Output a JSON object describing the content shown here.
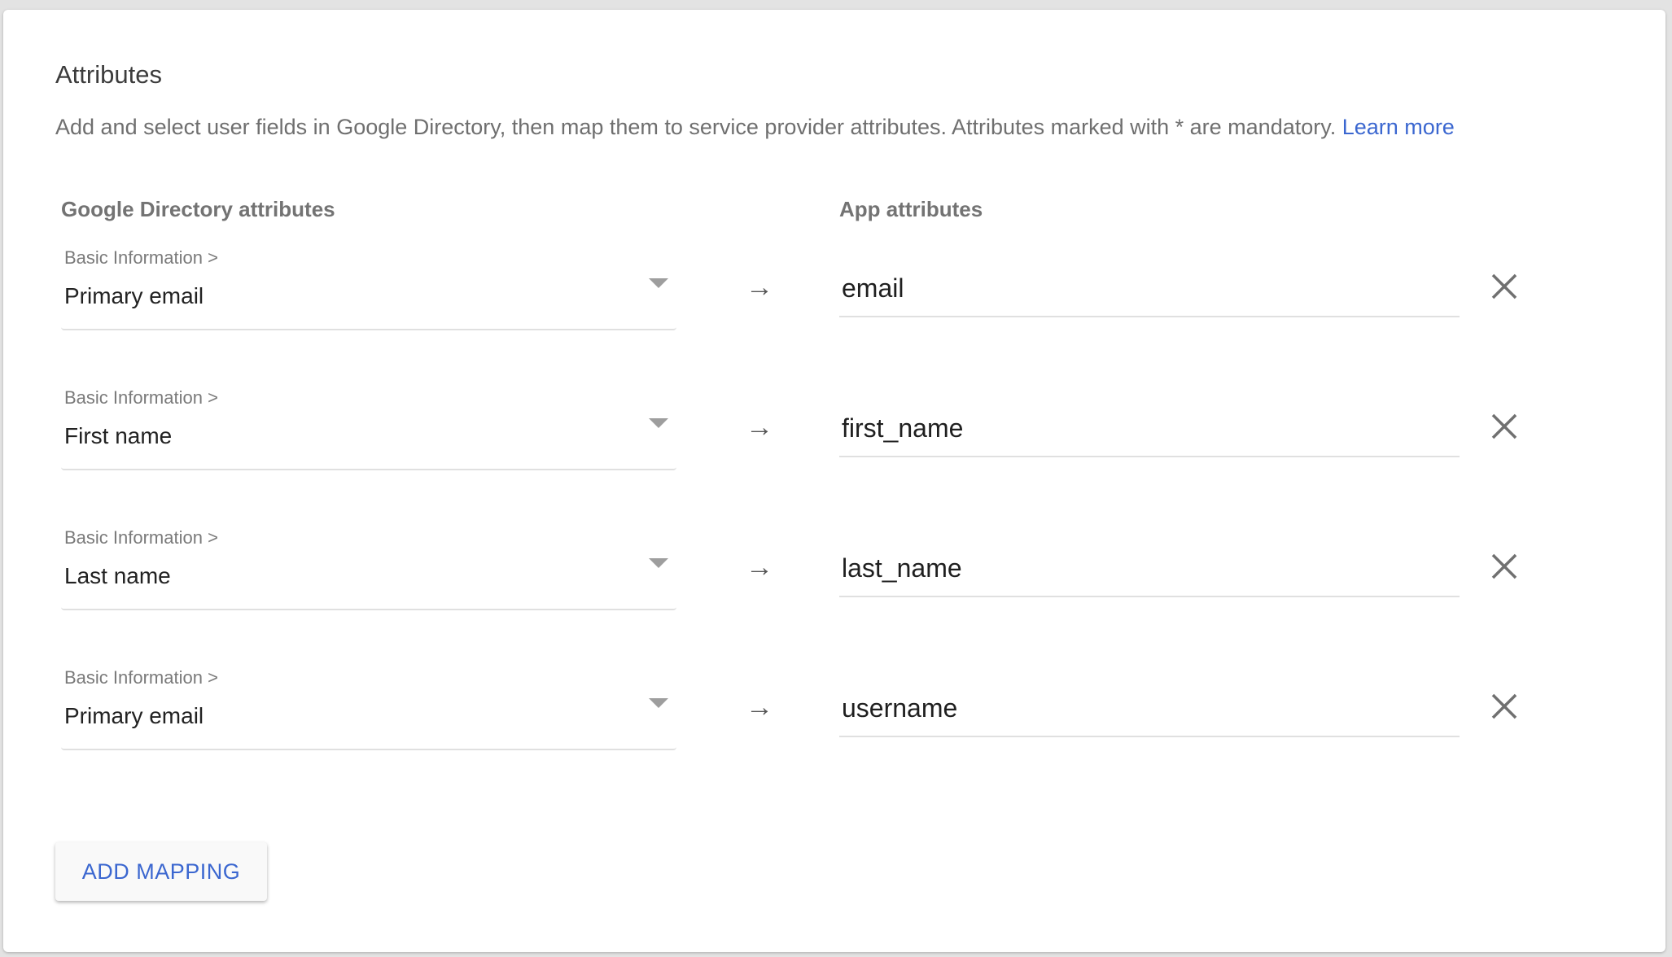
{
  "section": {
    "title": "Attributes",
    "description": "Add and select user fields in Google Directory, then map them to service provider attributes. Attributes marked with * are mandatory. ",
    "learn_more": "Learn more"
  },
  "columns": {
    "left": "Google Directory attributes",
    "right": "App attributes"
  },
  "mappings": [
    {
      "category": "Basic Information >",
      "field": "Primary email",
      "app_attribute": "email"
    },
    {
      "category": "Basic Information >",
      "field": "First name",
      "app_attribute": "first_name"
    },
    {
      "category": "Basic Information >",
      "field": "Last name",
      "app_attribute": "last_name"
    },
    {
      "category": "Basic Information >",
      "field": "Primary email",
      "app_attribute": "username"
    }
  ],
  "icons": {
    "arrow": "→",
    "dropdown": "arrow-drop-down",
    "remove": "close"
  },
  "add_button": "ADD MAPPING",
  "colors": {
    "accent": "#3b67d0",
    "muted_text": "#6f6f6f"
  }
}
